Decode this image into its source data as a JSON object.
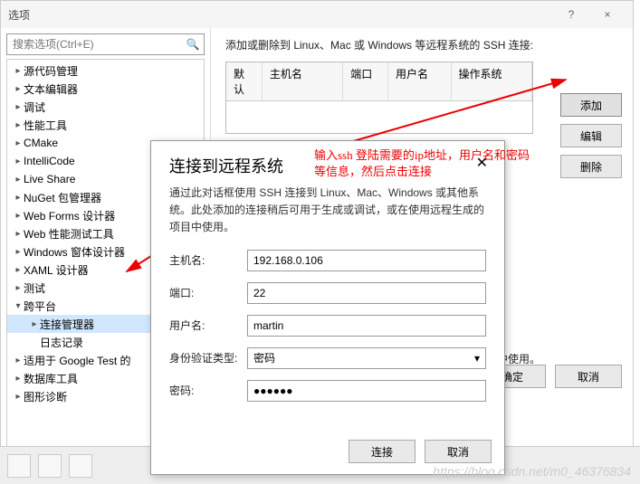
{
  "window": {
    "title": "选项",
    "help_icon": "?",
    "close_icon": "×"
  },
  "search": {
    "placeholder": "搜索选项(Ctrl+E)"
  },
  "tree": {
    "items": [
      {
        "label": "源代码管理",
        "level": 1,
        "expanded": false
      },
      {
        "label": "文本编辑器",
        "level": 1,
        "expanded": false
      },
      {
        "label": "调试",
        "level": 1,
        "expanded": false
      },
      {
        "label": "性能工具",
        "level": 1,
        "expanded": false
      },
      {
        "label": "CMake",
        "level": 1,
        "expanded": false
      },
      {
        "label": "IntelliCode",
        "level": 1,
        "expanded": false
      },
      {
        "label": "Live Share",
        "level": 1,
        "expanded": false
      },
      {
        "label": "NuGet 包管理器",
        "level": 1,
        "expanded": false
      },
      {
        "label": "Web Forms 设计器",
        "level": 1,
        "expanded": false
      },
      {
        "label": "Web 性能测试工具",
        "level": 1,
        "expanded": false
      },
      {
        "label": "Windows 窗体设计器",
        "level": 1,
        "expanded": false
      },
      {
        "label": "XAML 设计器",
        "level": 1,
        "expanded": false
      },
      {
        "label": "测试",
        "level": 1,
        "expanded": false
      },
      {
        "label": "跨平台",
        "level": 1,
        "expanded": true
      },
      {
        "label": "连接管理器",
        "level": 2,
        "expanded": false,
        "selected": true
      },
      {
        "label": "日志记录",
        "level": 2,
        "expanded": null
      },
      {
        "label": "适用于 Google Test 的",
        "level": 1,
        "expanded": false
      },
      {
        "label": "数据库工具",
        "level": 1,
        "expanded": false
      },
      {
        "label": "图形诊断",
        "level": 1,
        "expanded": false
      }
    ]
  },
  "right": {
    "desc": "添加或删除到 Linux、Mac 或 Windows 等远程系统的 SSH 连接:",
    "columns": [
      "默认",
      "主机名",
      "端口",
      "用户名",
      "操作系统"
    ],
    "buttons": {
      "add": "添加",
      "edit": "编辑",
      "delete": "删除"
    },
    "truncated_note": "项目中使用。",
    "ok": "确定",
    "cancel": "取消"
  },
  "dialog": {
    "title": "连接到远程系统",
    "desc": "通过此对话框使用 SSH 连接到 Linux、Mac、Windows 或其他系统。此处添加的连接稍后可用于生成或调试，或在使用远程生成的项目中使用。",
    "fields": {
      "host_label": "主机名:",
      "host_value": "192.168.0.106",
      "port_label": "端口:",
      "port_value": "22",
      "user_label": "用户名:",
      "user_value": "martin",
      "auth_label": "身份验证类型:",
      "auth_value": "密码",
      "password_label": "密码:",
      "password_value": "●●●●●●"
    },
    "connect": "连接",
    "cancel": "取消"
  },
  "annotation": {
    "line1": "输入ssh 登陆需要的ip地址，用户名和密码",
    "line2": "等信息，然后点击连接"
  },
  "watermark": "https://blog.csdn.net/m0_46376834"
}
